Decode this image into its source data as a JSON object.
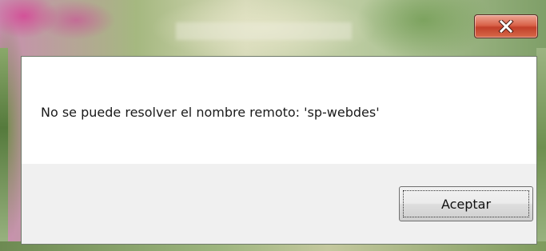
{
  "dialog": {
    "message": "No se puede resolver el nombre remoto: 'sp-webdes'",
    "ok_label": "Aceptar",
    "close_icon": "close-icon"
  },
  "colors": {
    "close_button": "#d9634a",
    "client_background": "#ffffff",
    "button_bar_background": "#f0f0f0"
  }
}
